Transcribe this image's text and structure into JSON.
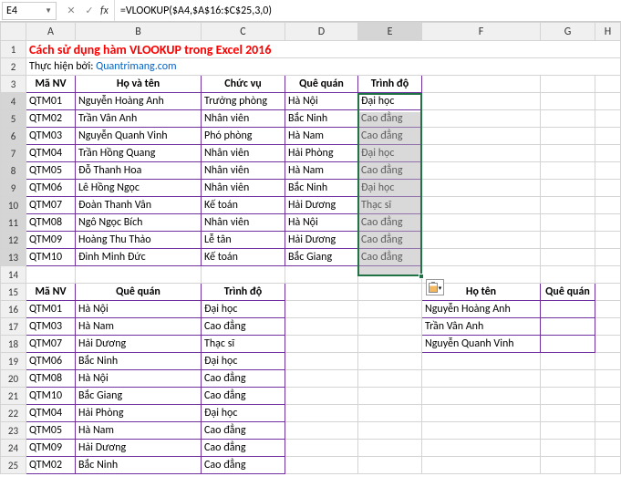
{
  "nameBox": "E4",
  "formula": "=VLOOKUP($A4,$A$16:$C$25,3,0)",
  "cols": [
    "A",
    "B",
    "C",
    "D",
    "E",
    "F",
    "G",
    "H"
  ],
  "selectedCol": "E",
  "rowCount": 25,
  "title": "Cách sử dụng hàm VLOOKUP trong Excel 2016",
  "creditPrefix": "Thực hiện bởi: ",
  "creditLink": "Quantrimang.com",
  "table1": {
    "headers": [
      "Mã NV",
      "Họ và tên",
      "Chức vụ",
      "Quê quán",
      "Trình độ"
    ],
    "rows": [
      [
        "QTM01",
        "Nguyễn Hoàng Anh",
        "Trưởng phòng",
        "Hà Nội",
        "Đại học"
      ],
      [
        "QTM02",
        "Trần Vân Anh",
        "Nhân viên",
        "Bắc Ninh",
        "Cao đẳng"
      ],
      [
        "QTM03",
        "Nguyễn Quanh Vinh",
        "Phó phòng",
        "Hà Nam",
        "Cao đẳng"
      ],
      [
        "QTM04",
        "Trần Hồng Quang",
        "Nhân viên",
        "Hải Phòng",
        "Đại học"
      ],
      [
        "QTM05",
        "Đỗ Thanh Hoa",
        "Nhân viên",
        "Hà Nam",
        "Cao đẳng"
      ],
      [
        "QTM06",
        "Lê Hồng Ngọc",
        "Nhân viên",
        "Bắc Ninh",
        "Đại học"
      ],
      [
        "QTM07",
        "Đoàn Thanh Vân",
        "Kế toán",
        "Hải Dương",
        "Thạc sĩ"
      ],
      [
        "QTM08",
        "Ngô Ngọc Bích",
        "Nhân viên",
        "Hà Nội",
        "Cao đẳng"
      ],
      [
        "QTM09",
        "Hoàng Thu Thảo",
        "Lễ tân",
        "Hải Dương",
        "Cao đẳng"
      ],
      [
        "QTM10",
        "Đinh Minh Đức",
        "Kế toán",
        "Bắc Giang",
        "Cao đẳng"
      ]
    ]
  },
  "table2": {
    "headers": [
      "Mã NV",
      "Quê quán",
      "Trình độ"
    ],
    "rows": [
      [
        "QTM01",
        "Hà Nội",
        "Đại học"
      ],
      [
        "QTM03",
        "Hà Nam",
        "Cao đẳng"
      ],
      [
        "QTM07",
        "Hải Dương",
        "Thạc sĩ"
      ],
      [
        "QTM06",
        "Bắc Ninh",
        "Đại học"
      ],
      [
        "QTM08",
        "Hà Nội",
        "Cao đẳng"
      ],
      [
        "QTM10",
        "Bắc Giang",
        "Cao đẳng"
      ],
      [
        "QTM04",
        "Hải Phòng",
        "Đại học"
      ],
      [
        "QTM05",
        "Hà Nam",
        "Cao đẳng"
      ],
      [
        "QTM09",
        "Hải Dương",
        "Cao đẳng"
      ],
      [
        "QTM02",
        "Bắc Ninh",
        "Cao đẳng"
      ]
    ]
  },
  "table3": {
    "headers": [
      "Họ tên",
      "Quê quán"
    ],
    "rows": [
      [
        "Nguyễn Hoàng Anh",
        ""
      ],
      [
        "Trần Vân Anh",
        ""
      ],
      [
        "Nguyễn Quanh Vinh",
        ""
      ]
    ]
  }
}
